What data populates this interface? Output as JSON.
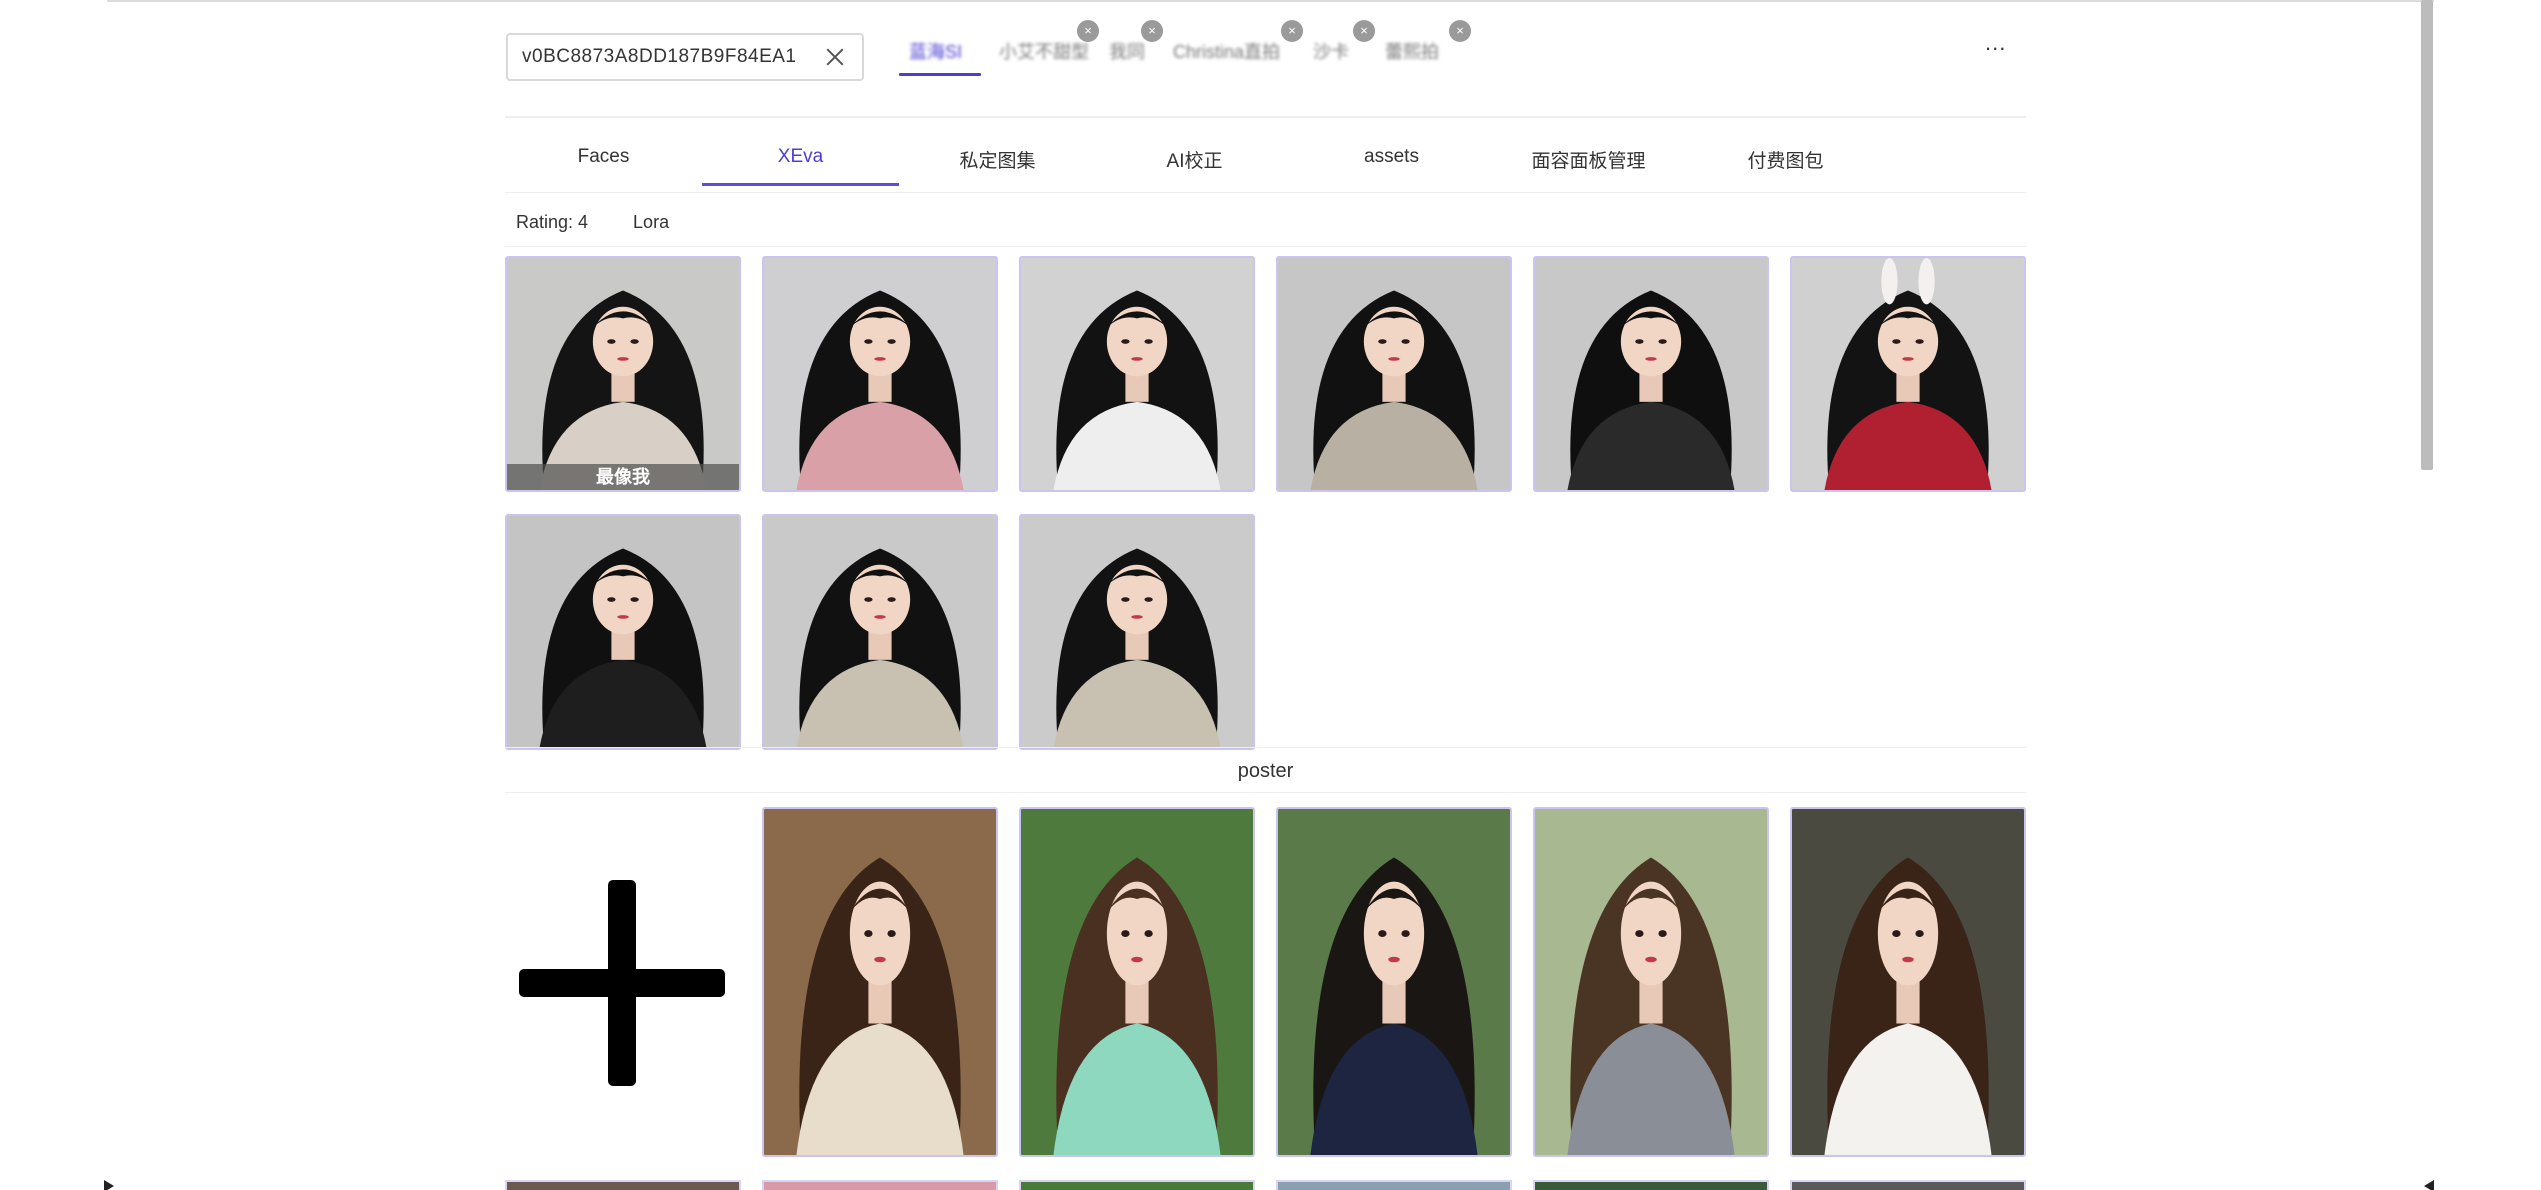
{
  "search": {
    "value": "v0BC8873A8DD187B9F84EA1",
    "clear_icon": "close-icon"
  },
  "profile_tabs": [
    {
      "label": "蓝海SI",
      "active": true,
      "closable": false
    },
    {
      "label": "小艾不甜型",
      "active": false,
      "closable": true
    },
    {
      "label": "我同",
      "active": false,
      "closable": true
    },
    {
      "label": "Christina直拍",
      "active": false,
      "closable": true
    },
    {
      "label": "沙卡",
      "active": false,
      "closable": true
    },
    {
      "label": "蕾熙拍",
      "active": false,
      "closable": true
    }
  ],
  "more_label": "...",
  "tabs": [
    {
      "label": "Faces",
      "active": false
    },
    {
      "label": "XEva",
      "active": true
    },
    {
      "label": "私定图集",
      "active": false
    },
    {
      "label": "AI校正",
      "active": false
    },
    {
      "label": "assets",
      "active": false
    },
    {
      "label": "面容面板管理",
      "active": false
    },
    {
      "label": "付费图包",
      "active": false
    }
  ],
  "meta": {
    "rating": "Rating: 4",
    "lora": "Lora"
  },
  "faces": [
    {
      "caption": "最像我",
      "bg": "#c9c9c7",
      "outfit": "#d8d0c6",
      "hair": "#141414"
    },
    {
      "caption": "",
      "bg": "#cfcfd2",
      "outfit": "#d9a0a8",
      "hair": "#111111"
    },
    {
      "caption": "",
      "bg": "#d2d2d2",
      "outfit": "#eeeeee",
      "hair": "#121212"
    },
    {
      "caption": "",
      "bg": "#c6c6c6",
      "outfit": "#b8b0a2",
      "hair": "#111111"
    },
    {
      "caption": "",
      "bg": "#c8c8c8",
      "outfit": "#2a2a2a",
      "hair": "#0f0f0f"
    },
    {
      "caption": "",
      "bg": "#d0d0d0",
      "outfit": "#b02030",
      "hair": "#131313",
      "ears": true
    },
    {
      "caption": "",
      "bg": "#c4c4c4",
      "outfit": "#1e1e1e",
      "hair": "#101010"
    },
    {
      "caption": "",
      "bg": "#c9c9c9",
      "outfit": "#c8c0b0",
      "hair": "#111111"
    },
    {
      "caption": "",
      "bg": "#cbcbcb",
      "outfit": "#c8c0b0",
      "hair": "#121212"
    }
  ],
  "poster_section": {
    "title": "poster",
    "add_icon": "plus-icon"
  },
  "posters": [
    {
      "bg": "#8a6a4a",
      "outfit": "#e8dccb",
      "hair": "#3a2418"
    },
    {
      "bg": "#4e7a3e",
      "outfit": "#8fd8c0",
      "hair": "#4a3020"
    },
    {
      "bg": "#5a7a4a",
      "outfit": "#1d2540",
      "hair": "#1a1614"
    },
    {
      "bg": "#a8b890",
      "outfit": "#8a8e96",
      "hair": "#4a3424"
    },
    {
      "bg": "#4a4a40",
      "outfit": "#f4f2ee",
      "hair": "#3a2418"
    }
  ],
  "peek_colors": [
    "#6a5a50",
    "#d89aa8",
    "#4a7a3a",
    "#8aa0b0",
    "#3a5a3a",
    "#5a5a5a"
  ],
  "accent": "#4a3fd0"
}
